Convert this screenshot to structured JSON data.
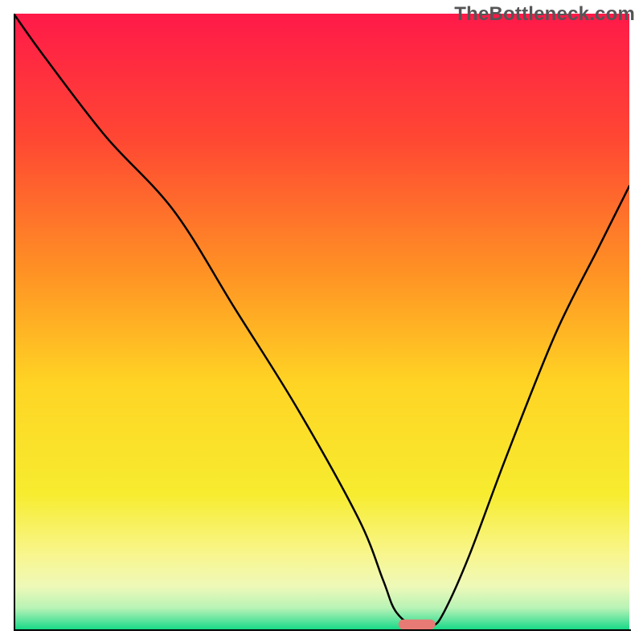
{
  "watermark": "TheBottleneck.com",
  "chart_data": {
    "type": "line",
    "title": "",
    "xlabel": "",
    "ylabel": "",
    "xlim": [
      0,
      100
    ],
    "ylim": [
      0,
      100
    ],
    "grid": false,
    "legend": false,
    "background": {
      "type": "vertical-gradient",
      "stops": [
        {
          "pos": 0.0,
          "color": "#ff1a49"
        },
        {
          "pos": 0.2,
          "color": "#ff4633"
        },
        {
          "pos": 0.42,
          "color": "#ff9224"
        },
        {
          "pos": 0.6,
          "color": "#ffd424"
        },
        {
          "pos": 0.78,
          "color": "#f7ec2f"
        },
        {
          "pos": 0.88,
          "color": "#f8f68f"
        },
        {
          "pos": 0.93,
          "color": "#eef9b8"
        },
        {
          "pos": 0.965,
          "color": "#b9f3b6"
        },
        {
          "pos": 0.985,
          "color": "#5fe49e"
        },
        {
          "pos": 1.0,
          "color": "#17d987"
        }
      ]
    },
    "series": [
      {
        "name": "bottleneck-curve",
        "color": "#000000",
        "x": [
          0,
          5,
          15,
          26,
          36,
          46,
          56,
          60,
          62,
          65,
          68,
          70,
          74,
          80,
          88,
          95,
          100
        ],
        "y": [
          100,
          93,
          80,
          68,
          52,
          36,
          18,
          8,
          3,
          0.5,
          0.5,
          3,
          12,
          28,
          48,
          62,
          72
        ]
      }
    ],
    "marker": {
      "name": "optimal-point",
      "shape": "pill",
      "color": "#e77a74",
      "x": 65.5,
      "y": 0.8,
      "width": 6,
      "height": 1.6
    }
  }
}
